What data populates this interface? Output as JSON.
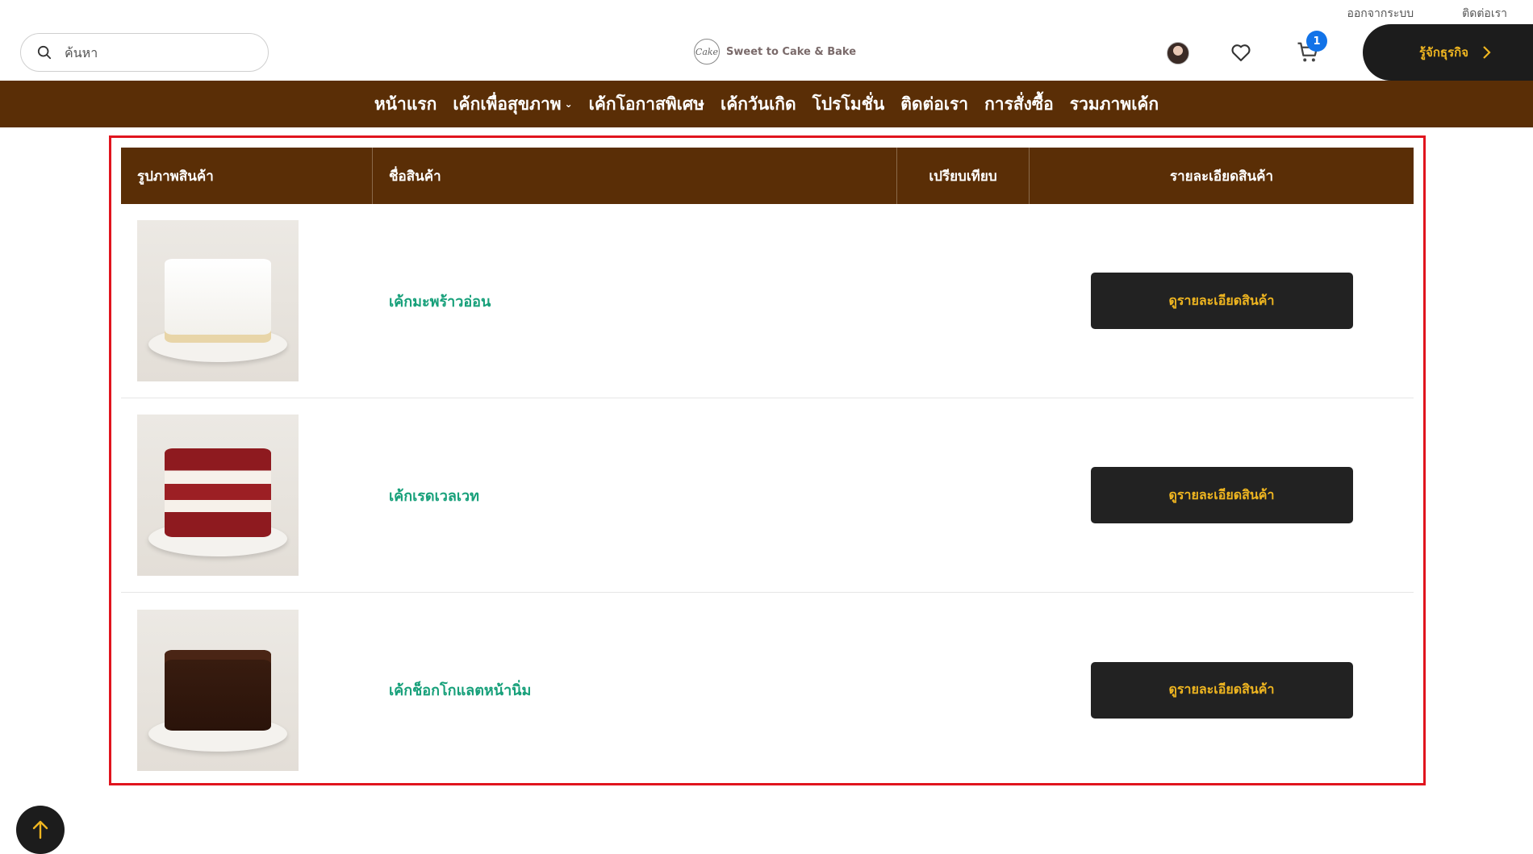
{
  "top_links": {
    "logout": "ออกจากระบบ",
    "contact": "ติดต่อเรา"
  },
  "search": {
    "placeholder": "ค้นหา"
  },
  "logo": {
    "name": "Sweet to Cake & Bake"
  },
  "cart": {
    "count": "1"
  },
  "cta": {
    "label": "รู้จักธุรกิจ"
  },
  "nav": {
    "items": [
      {
        "label": "หน้าแรก"
      },
      {
        "label": "เค้กเพื่อสุขภาพ"
      },
      {
        "label": "เค้กโอกาสพิเศษ"
      },
      {
        "label": "เค้กวันเกิด"
      },
      {
        "label": "โปรโมชั่น"
      },
      {
        "label": "ติดต่อเรา"
      },
      {
        "label": "การสั่งซื้อ"
      },
      {
        "label": "รวมภาพเค้ก"
      }
    ]
  },
  "table": {
    "headers": {
      "image": "รูปภาพสินค้า",
      "name": "ชื่อสินค้า",
      "compare": "เปรียบเทียบ",
      "details": "รายละเอียดสินค้า"
    },
    "rows": [
      {
        "name": "เค้กมะพร้าวอ่อน",
        "button": "ดูรายละเอียดสินค้า"
      },
      {
        "name": "เค้กเรดเวลเวท",
        "button": "ดูรายละเอียดสินค้า"
      },
      {
        "name": "เค้กช็อกโกแลตหน้านิ่ม",
        "button": "ดูรายละเอียดสินค้า"
      }
    ]
  },
  "colors": {
    "nav_bg": "#5a2e06",
    "accent_gold": "#f0b620",
    "product_green": "#17a07a",
    "highlight_red": "#e0141e"
  }
}
